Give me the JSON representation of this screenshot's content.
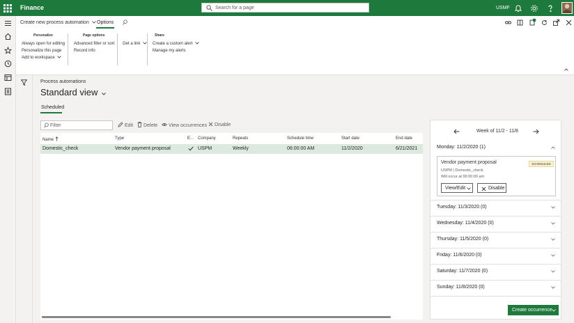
{
  "topbar": {
    "app_name": "Finance",
    "search_placeholder": "Search for a page",
    "company": "USMF"
  },
  "actionbar": {
    "process_menu_label": "Create new process automation",
    "options_tab": "Options"
  },
  "actionpane": {
    "personalize": {
      "header": "Personalize",
      "items": [
        "Always open for editing",
        "Personalize this page",
        "Add to workspace"
      ]
    },
    "page_options": {
      "header": "Page options",
      "items": [
        "Advanced filter or sort",
        "Record info"
      ]
    },
    "get_link": "Get a link",
    "share": {
      "header": "Share",
      "items": [
        "Create a custom alert",
        "Manage my alerts"
      ]
    }
  },
  "page": {
    "caption": "Process automations",
    "view_title": "Standard view",
    "tab_scheduled": "Scheduled"
  },
  "toolbar": {
    "filter_placeholder": "Filter",
    "edit": "Edit",
    "delete": "Delete",
    "view_occurrences": "View occurrences",
    "disable": "Disable"
  },
  "grid": {
    "columns": [
      "Name",
      "Type",
      "E...",
      "Company",
      "Repeats",
      "Schedule time",
      "Start date",
      "End date"
    ],
    "rows": [
      {
        "name": "Domestic_check",
        "type": "Vendor payment proposal",
        "enabled": true,
        "company": "USPM",
        "repeats": "Weekly",
        "schedule_time": "06:00:00 AM",
        "start_date": "11/2/2020",
        "end_date": "6/21/2021"
      }
    ]
  },
  "calendar": {
    "week_label": "Week of 11/2 - 11/8",
    "days": [
      "Monday: 11/2/2020 (1)",
      "Tuesday: 11/3/2020 (0)",
      "Wednesday: 11/4/2020 (0)",
      "Thursday: 11/5/2020 (0)",
      "Friday: 11/6/2020 (0)",
      "Saturday: 11/7/2020 (0)",
      "Sunday: 11/8/2020 (0)"
    ],
    "occurrence": {
      "title": "Vendor payment proposal",
      "badge": "SCHEDULED",
      "line1": "USPM | Domestic_check",
      "line2": "Will occur at 06:00:00 am",
      "view_edit": "View/Edit",
      "disable": "Disable"
    },
    "create_button": "Create occurrence"
  },
  "colors": {
    "brand": "#1d7a3c",
    "selected_row": "#dbe9df"
  }
}
